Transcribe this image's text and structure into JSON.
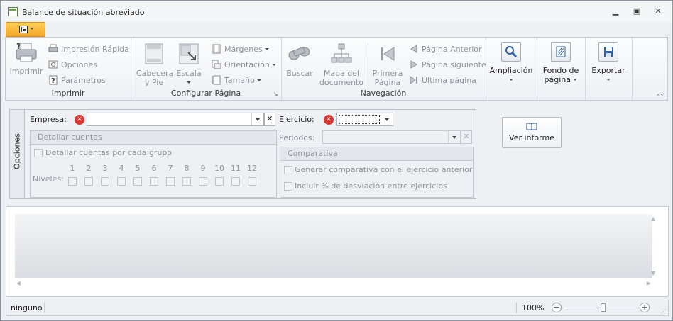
{
  "window": {
    "title": "Balance de situación abreviado"
  },
  "ribbon": {
    "groups": {
      "imprimir": {
        "label": "Imprimir",
        "print": "Imprimir",
        "quick_print": "Impresión Rápida",
        "options": "Opciones",
        "parameters": "Parámetros"
      },
      "configurar": {
        "label": "Configurar Página",
        "header_footer_1": "Cabecera",
        "header_footer_2": "y Pie",
        "scale": "Escala",
        "margins": "Márgenes",
        "orientation": "Orientación",
        "size": "Tamaño"
      },
      "navegacion": {
        "label": "Navegación",
        "search": "Buscar",
        "doc_map_1": "Mapa del",
        "doc_map_2": "documento",
        "first_page_1": "Primera",
        "first_page_2": "Página",
        "prev_page": "Página Anterior",
        "next_page": "Página siguiente",
        "last_page": "Última página"
      },
      "zoom": {
        "label": "Ampliación"
      },
      "background": {
        "label_1": "Fondo de",
        "label_2": "página"
      },
      "export": {
        "label": "Exportar"
      }
    }
  },
  "options": {
    "tab_label": "Opciones",
    "empresa_label": "Empresa:",
    "empresa_value": "",
    "ejercicio_label": "Ejercicio:",
    "ejercicio_value": "",
    "detail": {
      "title": "Detallar cuentas",
      "per_group": "Detallar cuentas por cada grupo",
      "levels_label": "Niveles:",
      "levels": [
        "1",
        "2",
        "3",
        "4",
        "5",
        "6",
        "7",
        "8",
        "9",
        "10",
        "11",
        "12"
      ]
    },
    "periodos_label": "Periodos:",
    "comparativa": {
      "title": "Comparativa",
      "generate": "Generar comparativa con el ejercicio anterior",
      "include_pct": "Incluir % de desviación entre ejercicios"
    },
    "view_report": "Ver informe"
  },
  "status": {
    "text": "ninguno",
    "zoom": "100%",
    "zoom_level": 0.5
  }
}
